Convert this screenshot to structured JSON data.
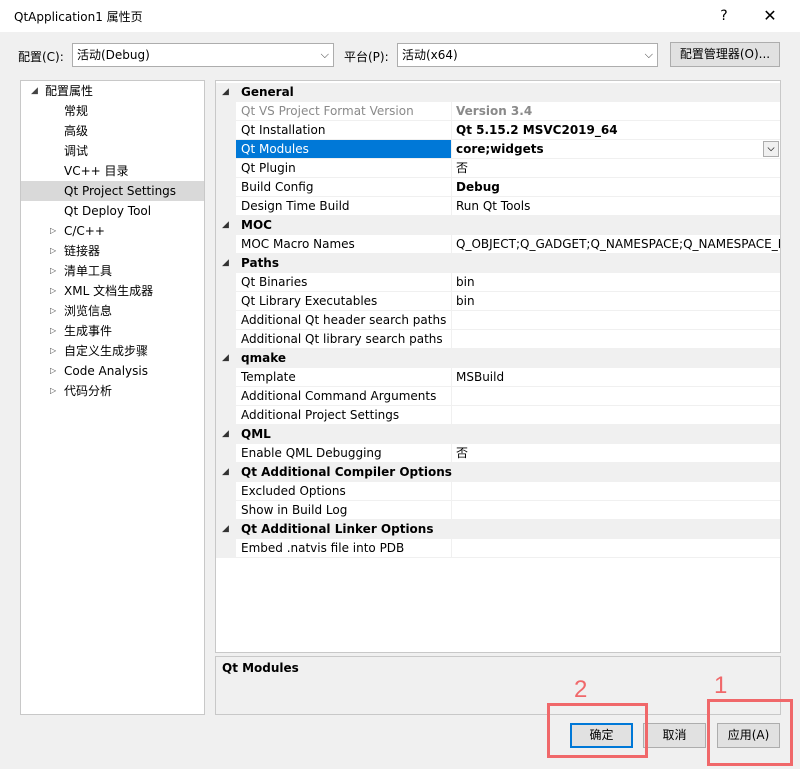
{
  "window": {
    "title": "QtApplication1 属性页",
    "help": "?",
    "close": "✕"
  },
  "config": {
    "config_label": "配置(C):",
    "config_value": "活动(Debug)",
    "platform_label": "平台(P):",
    "platform_value": "活动(x64)",
    "manager_button": "配置管理器(O)..."
  },
  "tree": {
    "root": "配置属性",
    "items": [
      {
        "label": "常规"
      },
      {
        "label": "高级"
      },
      {
        "label": "调试"
      },
      {
        "label": "VC++ 目录"
      },
      {
        "label": "Qt Project Settings"
      },
      {
        "label": "Qt Deploy Tool"
      },
      {
        "label": "C/C++"
      },
      {
        "label": "链接器"
      },
      {
        "label": "清单工具"
      },
      {
        "label": "XML 文档生成器"
      },
      {
        "label": "浏览信息"
      },
      {
        "label": "生成事件"
      },
      {
        "label": "自定义生成步骤"
      },
      {
        "label": "Code Analysis"
      },
      {
        "label": "代码分析"
      }
    ]
  },
  "grid": {
    "general": {
      "title": "General",
      "rows": [
        {
          "name": "Qt VS Project Format Version",
          "value": "Version 3.4"
        },
        {
          "name": "Qt Installation",
          "value": "Qt 5.15.2 MSVC2019_64"
        },
        {
          "name": "Qt Modules",
          "value": "core;widgets"
        },
        {
          "name": "Qt Plugin",
          "value": "否"
        },
        {
          "name": "Build Config",
          "value": "Debug"
        },
        {
          "name": "Design Time Build",
          "value": "Run Qt Tools"
        }
      ]
    },
    "moc": {
      "title": "MOC",
      "rows": [
        {
          "name": "MOC Macro Names",
          "value": "Q_OBJECT;Q_GADGET;Q_NAMESPACE;Q_NAMESPACE_EX"
        }
      ]
    },
    "paths": {
      "title": "Paths",
      "rows": [
        {
          "name": "Qt Binaries",
          "value": "bin"
        },
        {
          "name": "Qt Library Executables",
          "value": "bin"
        },
        {
          "name": "Additional Qt header search paths",
          "value": ""
        },
        {
          "name": "Additional Qt library search paths",
          "value": ""
        }
      ]
    },
    "qmake": {
      "title": "qmake",
      "rows": [
        {
          "name": "Template",
          "value": "MSBuild"
        },
        {
          "name": "Additional Command Arguments",
          "value": ""
        },
        {
          "name": "Additional Project Settings",
          "value": ""
        }
      ]
    },
    "qml": {
      "title": "QML",
      "rows": [
        {
          "name": "Enable QML Debugging",
          "value": "否"
        }
      ]
    },
    "compiler": {
      "title": "Qt Additional Compiler Options",
      "rows": [
        {
          "name": "Excluded Options",
          "value": ""
        },
        {
          "name": "Show in Build Log",
          "value": ""
        }
      ]
    },
    "linker": {
      "title": "Qt Additional Linker Options",
      "rows": [
        {
          "name": "Embed .natvis file into PDB",
          "value": ""
        }
      ]
    }
  },
  "description": {
    "title": "Qt Modules"
  },
  "buttons": {
    "ok": "确定",
    "cancel": "取消",
    "apply": "应用(A)"
  },
  "annotations": {
    "label_1": "1",
    "label_2": "2",
    "color": "#f0686a"
  },
  "colors": {
    "selection": "#0078d7",
    "tree_selected": "#d9d9d9"
  }
}
